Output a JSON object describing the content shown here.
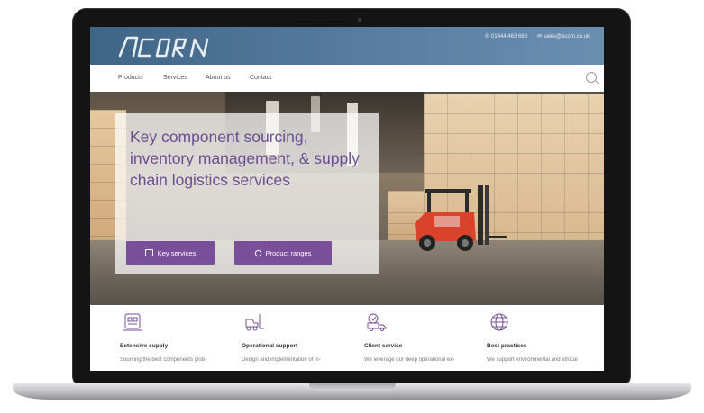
{
  "site": {
    "logo": "ACORN",
    "phone": "01444 463 663",
    "email": "sales@acorn.co.uk",
    "colors": {
      "brand_purple": "#7a4f9a",
      "header_blue": "#4a7092",
      "title_purple": "#6a4f92"
    }
  },
  "nav": {
    "items": [
      {
        "label": "Products"
      },
      {
        "label": "Services"
      },
      {
        "label": "About us"
      },
      {
        "label": "Contact"
      }
    ],
    "search_icon": "search-icon"
  },
  "hero": {
    "title": "Key component sourcing, inventory management, & supply chain logistics services",
    "buttons": [
      {
        "label": "Key services",
        "icon": "grid-icon"
      },
      {
        "label": "Product ranges",
        "icon": "cube-icon"
      }
    ]
  },
  "features": [
    {
      "title": "Extensive supply",
      "desc": "Sourcing the best components glob-",
      "icon": "supply-icon"
    },
    {
      "title": "Operational support",
      "desc": "Design and implementation of in-",
      "icon": "forklift-icon"
    },
    {
      "title": "Client service",
      "desc": "We leverage our deep operational ex-",
      "icon": "truck-icon"
    },
    {
      "title": "Best practices",
      "desc": "We support environmental and ethical",
      "icon": "globe-icon"
    }
  ]
}
